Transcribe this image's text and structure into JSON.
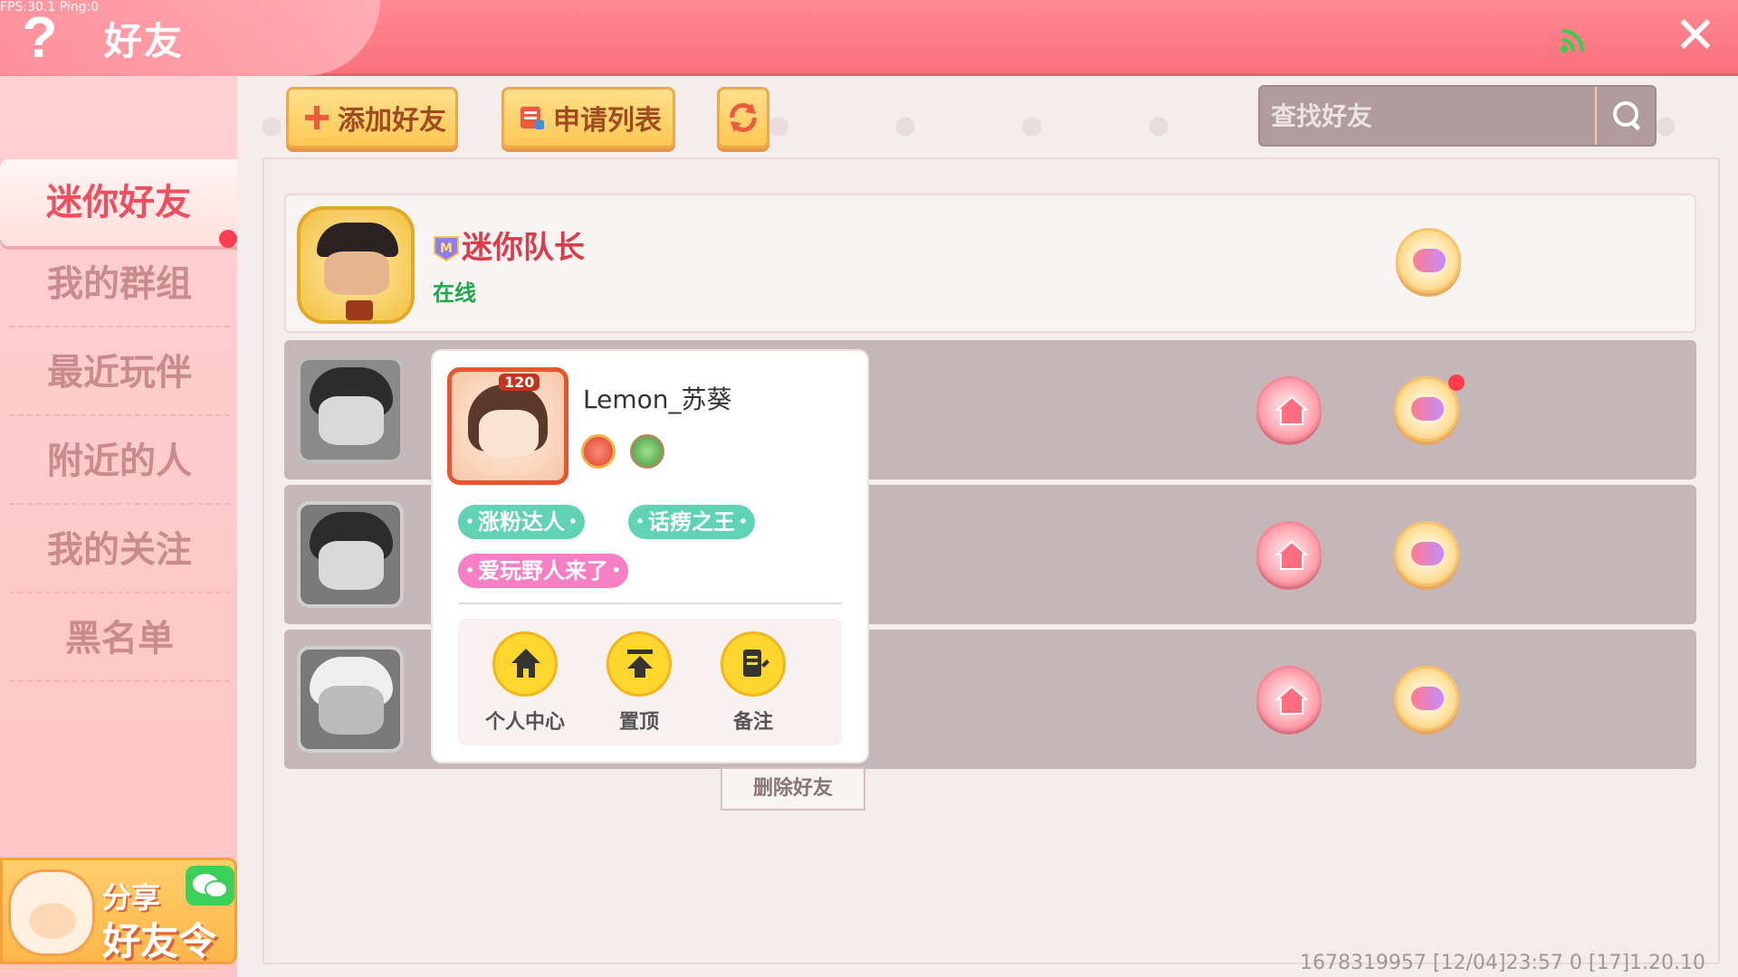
{
  "debug": {
    "fps_text": "FPS:30.1  Ping:0"
  },
  "header": {
    "title": "好友",
    "help_icon": "?",
    "close_icon": "✕"
  },
  "sidebar": {
    "items": [
      {
        "label": "迷你好友",
        "active": true
      },
      {
        "label": "我的群组"
      },
      {
        "label": "最近玩伴"
      },
      {
        "label": "附近的人"
      },
      {
        "label": "我的关注"
      },
      {
        "label": "黑名单"
      }
    ],
    "share": {
      "line1": "分享",
      "line2": "好友令"
    }
  },
  "toolbar": {
    "add_friend_label": "添加好友",
    "apply_list_label": "申请列表"
  },
  "search": {
    "placeholder": "查找好友"
  },
  "friends": [
    {
      "name": "迷你队长",
      "status": "在线"
    }
  ],
  "popup": {
    "level": "120",
    "name": "Lemon_苏葵",
    "tags": [
      "涨粉达人",
      "话痨之王",
      "爱玩野人来了"
    ],
    "actions": [
      "个人中心",
      "置顶",
      "备注"
    ],
    "delete_label": "删除好友"
  },
  "footer": {
    "info": "1678319957   [12/04]23:57 0  [17]1.20.10"
  },
  "colors": {
    "header": "#f9707c",
    "accent": "#ef4e5e",
    "online": "#1da84a",
    "row_bg": "#c5b6b7"
  }
}
